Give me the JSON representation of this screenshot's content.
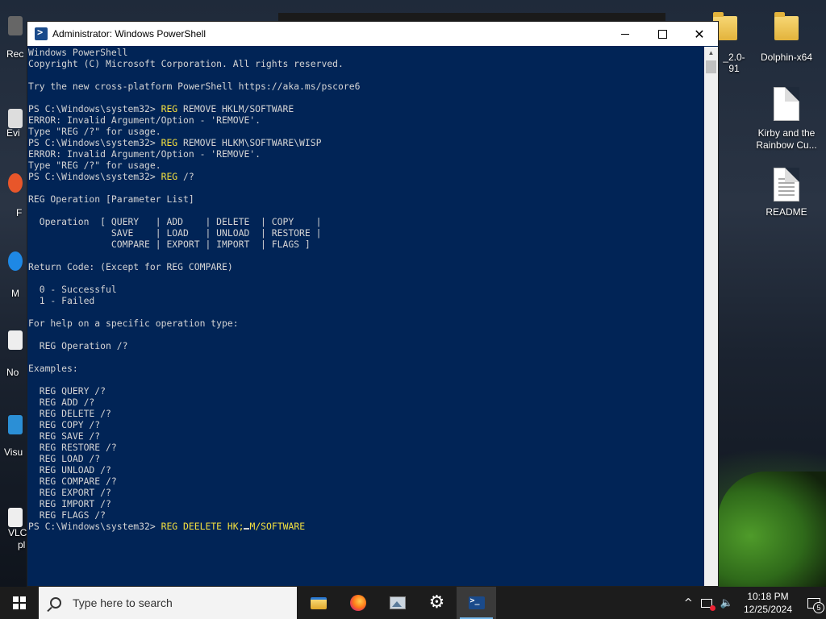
{
  "window": {
    "title": "Administrator: Windows PowerShell",
    "controls": {
      "minimize": "",
      "maximize": "",
      "close": "✕"
    }
  },
  "console": {
    "lines": [
      {
        "t": "Windows PowerShell"
      },
      {
        "t": "Copyright (C) Microsoft Corporation. All rights reserved."
      },
      {
        "t": ""
      },
      {
        "t": "Try the new cross-platform PowerShell https://aka.ms/pscore6"
      },
      {
        "t": ""
      },
      {
        "p": "PS C:\\Windows\\system32> ",
        "c": "REG",
        "a": " REMOVE HKLM/SOFTWARE"
      },
      {
        "t": "ERROR: Invalid Argument/Option - 'REMOVE'."
      },
      {
        "t": "Type \"REG /?\" for usage."
      },
      {
        "p": "PS C:\\Windows\\system32> ",
        "c": "REG",
        "a": " REMOVE HLKM\\SOFTWARE\\WISP"
      },
      {
        "t": "ERROR: Invalid Argument/Option - 'REMOVE'."
      },
      {
        "t": "Type \"REG /?\" for usage."
      },
      {
        "p": "PS C:\\Windows\\system32> ",
        "c": "REG",
        "a": " /?"
      },
      {
        "t": ""
      },
      {
        "t": "REG Operation [Parameter List]"
      },
      {
        "t": ""
      },
      {
        "t": "  Operation  [ QUERY   | ADD    | DELETE  | COPY    |"
      },
      {
        "t": "               SAVE    | LOAD   | UNLOAD  | RESTORE |"
      },
      {
        "t": "               COMPARE | EXPORT | IMPORT  | FLAGS ]"
      },
      {
        "t": ""
      },
      {
        "t": "Return Code: (Except for REG COMPARE)"
      },
      {
        "t": ""
      },
      {
        "t": "  0 - Successful"
      },
      {
        "t": "  1 - Failed"
      },
      {
        "t": ""
      },
      {
        "t": "For help on a specific operation type:"
      },
      {
        "t": ""
      },
      {
        "t": "  REG Operation /?"
      },
      {
        "t": ""
      },
      {
        "t": "Examples:"
      },
      {
        "t": ""
      },
      {
        "t": "  REG QUERY /?"
      },
      {
        "t": "  REG ADD /?"
      },
      {
        "t": "  REG DELETE /?"
      },
      {
        "t": "  REG COPY /?"
      },
      {
        "t": "  REG SAVE /?"
      },
      {
        "t": "  REG RESTORE /?"
      },
      {
        "t": "  REG LOAD /?"
      },
      {
        "t": "  REG UNLOAD /?"
      },
      {
        "t": "  REG COMPARE /?"
      },
      {
        "t": "  REG EXPORT /?"
      },
      {
        "t": "  REG IMPORT /?"
      },
      {
        "t": "  REG FLAGS /?"
      }
    ],
    "input": {
      "prompt": "PS C:\\Windows\\system32> ",
      "command_before_cursor": "REG DEELETE HK;",
      "command_after_cursor": "M/SOFTWARE"
    }
  },
  "desktop": {
    "icons_right": [
      {
        "label": "_2.0-91"
      },
      {
        "label": "Dolphin-x64"
      },
      {
        "label": "Kirby and the Rainbow Cu..."
      },
      {
        "label": "README"
      }
    ],
    "left_labels": [
      "Rec",
      "Evi",
      "F",
      "M",
      "No",
      "Visu",
      "VLC",
      "pl"
    ]
  },
  "taskbar": {
    "search_placeholder": "Type here to search",
    "apps": [
      "file-explorer",
      "firefox",
      "image-viewer",
      "settings",
      "powershell"
    ],
    "clock_time": "10:18 PM",
    "clock_date": "12/25/2024",
    "notification_count": "5"
  }
}
